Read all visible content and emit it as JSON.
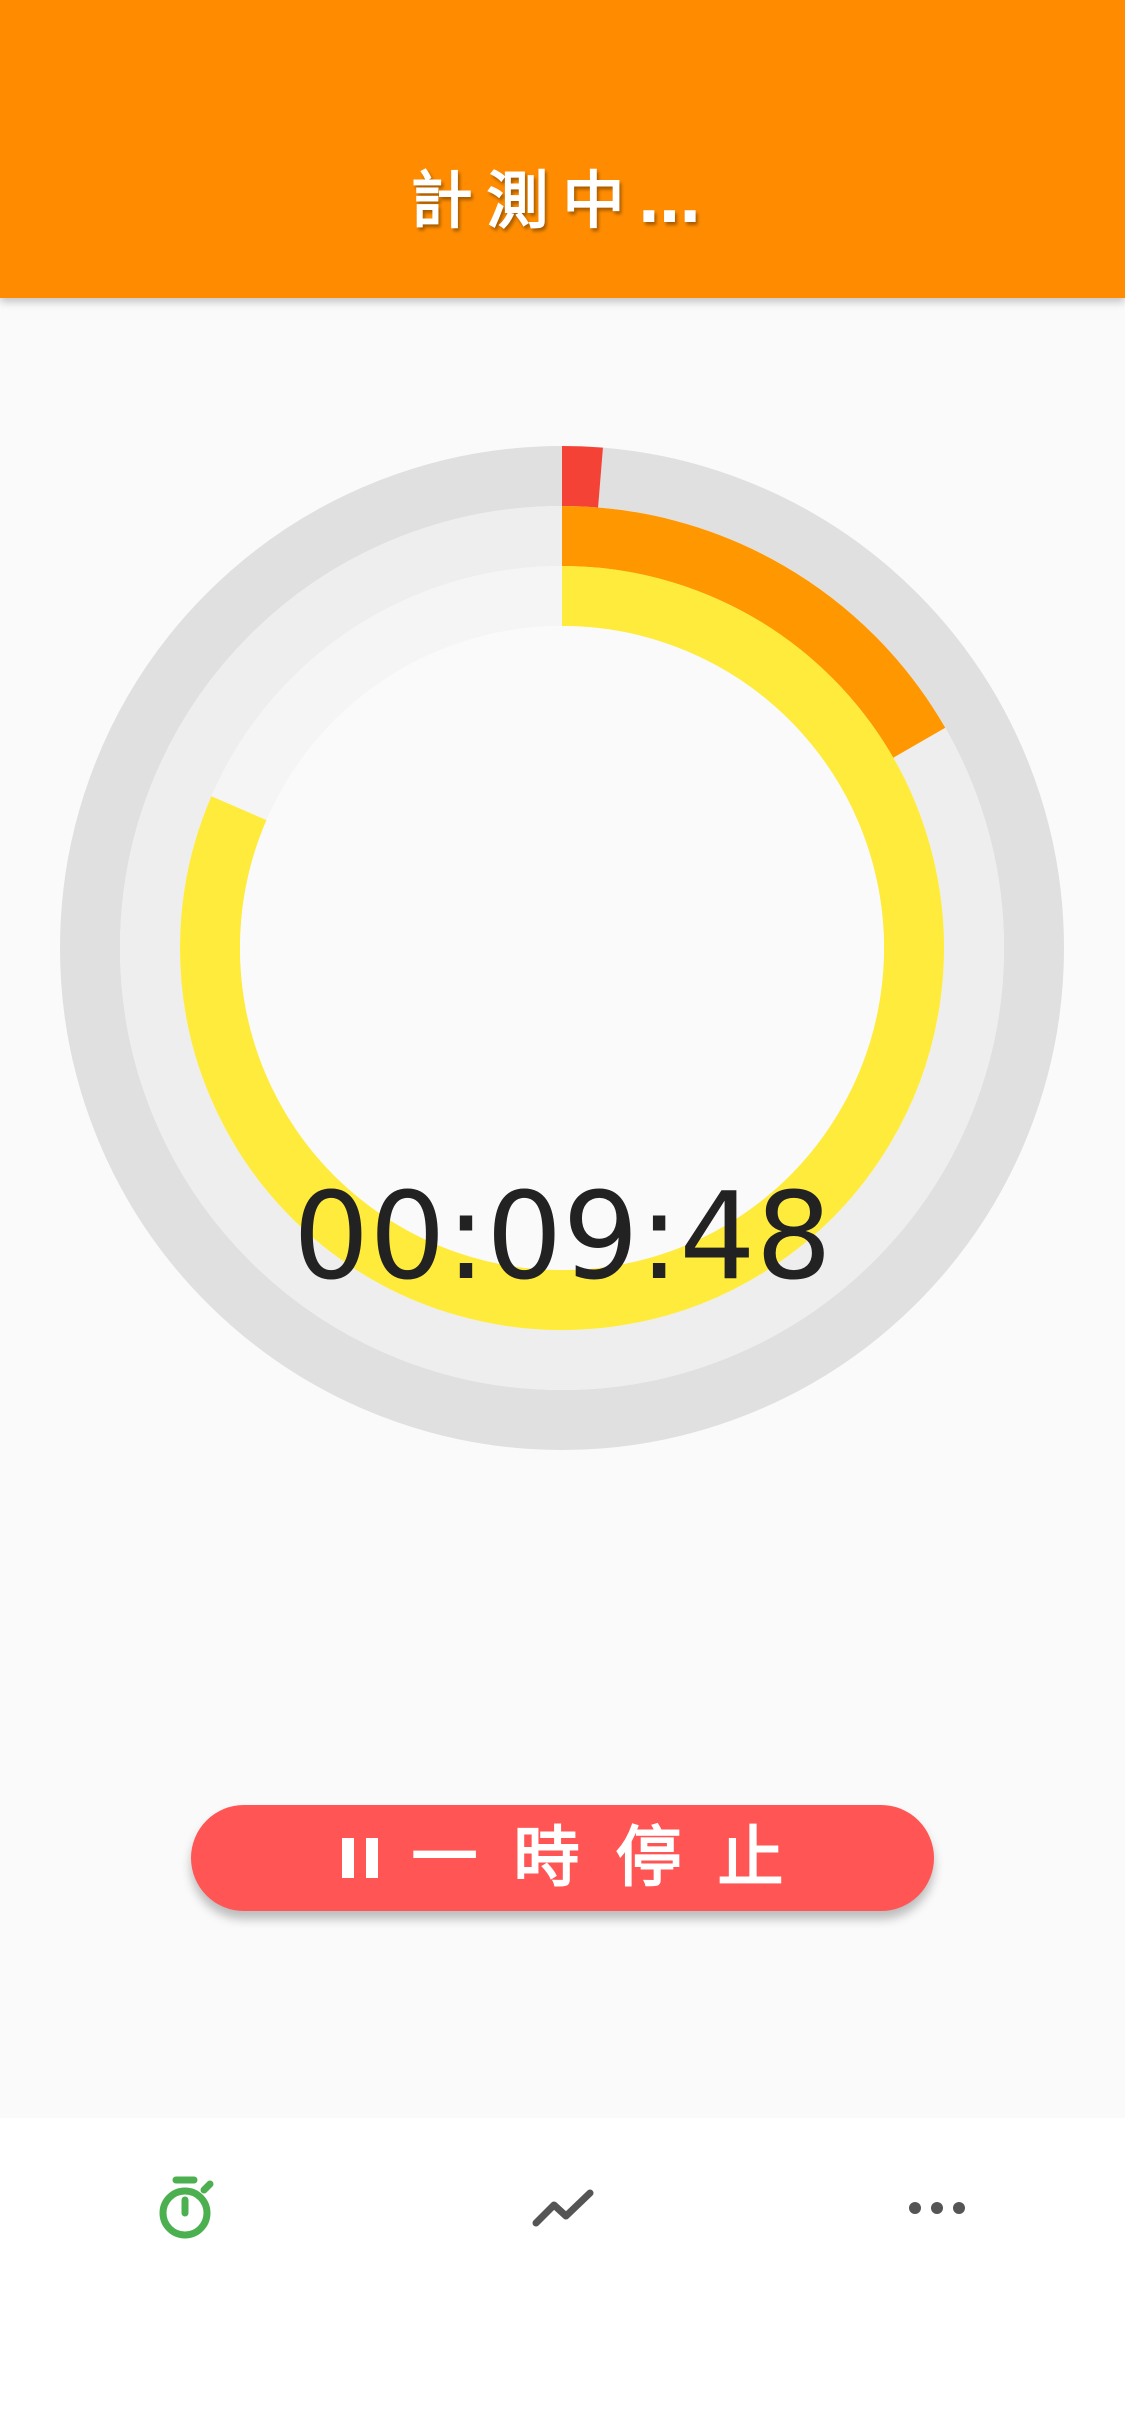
{
  "header": {
    "title": "計測中…"
  },
  "timer": {
    "elapsed": "00:09:48",
    "rings": {
      "outer_fraction": 0.013,
      "middle_fraction": 0.167,
      "inner_fraction": 0.815
    }
  },
  "controls": {
    "pause_label": "一時停止"
  },
  "bottom_nav": {
    "items": [
      {
        "icon": "stopwatch-icon",
        "active": true
      },
      {
        "icon": "trend-chart-icon",
        "active": false
      },
      {
        "icon": "more-horizontal-icon",
        "active": false
      }
    ]
  },
  "colors": {
    "header": "#ff8c00",
    "outer_ring": "#f44336",
    "middle_ring": "#ff9800",
    "inner_ring": "#ffeb3b",
    "outer_track": "#e0e0e0",
    "middle_track": "#eeeeee",
    "inner_track": "#f5f5f5",
    "pause_button": "#ff5555",
    "nav_active": "#4caf50",
    "nav_inactive": "#555555"
  }
}
